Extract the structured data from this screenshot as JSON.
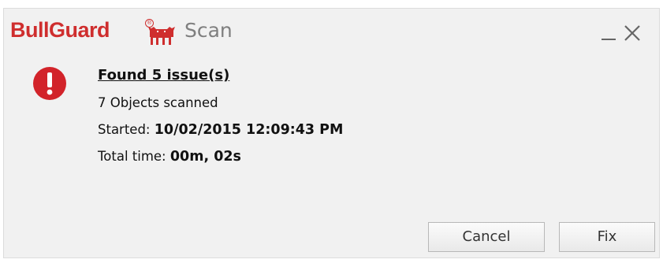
{
  "app": {
    "brand": "BullGuard",
    "registered_mark": "®",
    "title": "Scan"
  },
  "icons": {
    "logo": "bull-logo-icon",
    "minimize": "minimize-icon",
    "close": "close-icon",
    "alert": "alert-icon"
  },
  "colors": {
    "brand_red": "#cf2e2e",
    "alert_red": "#d2232a",
    "title_gray": "#7f7f7f",
    "window_bg": "#f1f1f1"
  },
  "scan": {
    "headline": "Found 5 issue(s)",
    "objects_scanned": "7 Objects scanned",
    "started_label": "Started: ",
    "started_value": "10/02/2015 12:09:43 PM",
    "total_time_label": "Total time: ",
    "total_time_value": "00m, 02s"
  },
  "buttons": {
    "cancel": "Cancel",
    "fix": "Fix"
  }
}
